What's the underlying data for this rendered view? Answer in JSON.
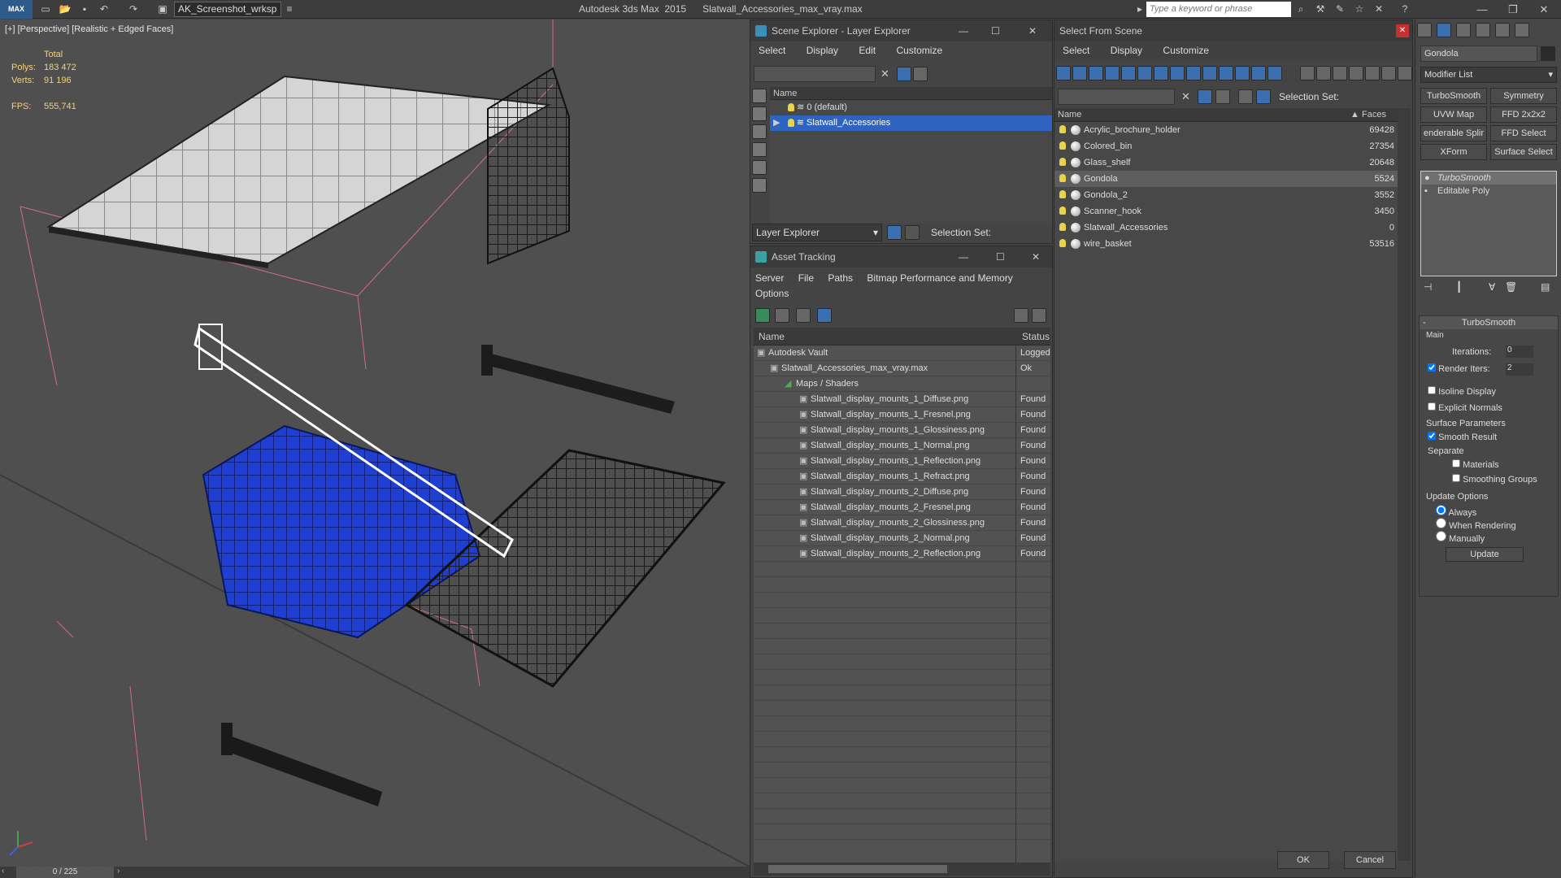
{
  "titlebar": {
    "logo": "MAX",
    "workspace": "AK_Screenshot_wrksp",
    "app_name": "Autodesk 3ds Max  2015",
    "file_name": "Slatwall_Accessories_max_vray.max",
    "search_placeholder": "Type a keyword or phrase"
  },
  "viewport": {
    "label": "[+] [Perspective] [Realistic + Edged Faces]",
    "stats_total": "Total",
    "polys_label": "Polys:",
    "polys_value": "183 472",
    "verts_label": "Verts:",
    "verts_value": "91 196",
    "fps_label": "FPS:",
    "fps_value": "555,741",
    "timeline": "0 / 225"
  },
  "scene_explorer": {
    "title": "Scene Explorer - Layer Explorer",
    "menu": [
      "Select",
      "Display",
      "Edit",
      "Customize"
    ],
    "col_name": "Name",
    "layers": [
      "0 (default)",
      "Slatwall_Accessories"
    ],
    "footer_combo": "Layer Explorer",
    "selection_set": "Selection Set:"
  },
  "asset_tracking": {
    "title": "Asset Tracking",
    "menu": [
      "Server",
      "File",
      "Paths",
      "Bitmap Performance and Memory",
      "Options"
    ],
    "col_name": "Name",
    "col_status": "Status",
    "rows": [
      {
        "name": "Autodesk Vault",
        "status": "Logged"
      },
      {
        "name": "Slatwall_Accessories_max_vray.max",
        "status": "Ok"
      },
      {
        "name": "Maps / Shaders",
        "status": ""
      },
      {
        "name": "Slatwall_display_mounts_1_Diffuse.png",
        "status": "Found"
      },
      {
        "name": "Slatwall_display_mounts_1_Fresnel.png",
        "status": "Found"
      },
      {
        "name": "Slatwall_display_mounts_1_Glossiness.png",
        "status": "Found"
      },
      {
        "name": "Slatwall_display_mounts_1_Normal.png",
        "status": "Found"
      },
      {
        "name": "Slatwall_display_mounts_1_Reflection.png",
        "status": "Found"
      },
      {
        "name": "Slatwall_display_mounts_1_Refract.png",
        "status": "Found"
      },
      {
        "name": "Slatwall_display_mounts_2_Diffuse.png",
        "status": "Found"
      },
      {
        "name": "Slatwall_display_mounts_2_Fresnel.png",
        "status": "Found"
      },
      {
        "name": "Slatwall_display_mounts_2_Glossiness.png",
        "status": "Found"
      },
      {
        "name": "Slatwall_display_mounts_2_Normal.png",
        "status": "Found"
      },
      {
        "name": "Slatwall_display_mounts_2_Reflection.png",
        "status": "Found"
      }
    ]
  },
  "select_from_scene": {
    "title": "Select From Scene",
    "menu": [
      "Select",
      "Display",
      "Customize"
    ],
    "selection_set": "Selection Set:",
    "col_name": "Name",
    "col_faces": "Faces",
    "objects": [
      {
        "name": "Acrylic_brochure_holder",
        "faces": "69428"
      },
      {
        "name": "Colored_bin",
        "faces": "27354"
      },
      {
        "name": "Glass_shelf",
        "faces": "20648"
      },
      {
        "name": "Gondola",
        "faces": "5524"
      },
      {
        "name": "Gondola_2",
        "faces": "3552"
      },
      {
        "name": "Scanner_hook",
        "faces": "3450"
      },
      {
        "name": "Slatwall_Accessories",
        "faces": "0"
      },
      {
        "name": "wire_basket",
        "faces": "53516"
      }
    ],
    "ok": "OK",
    "cancel": "Cancel"
  },
  "command_panel": {
    "object_name": "Gondola",
    "modifier_list": "Modifier List",
    "buttons": [
      "TurboSmooth",
      "Symmetry",
      "UVW Map",
      "FFD 2x2x2",
      "enderable Splir",
      "FFD Select",
      "XForm",
      "Surface Select"
    ],
    "stack": [
      "TurboSmooth",
      "Editable Poly"
    ],
    "rollout_title": "TurboSmooth",
    "main_label": "Main",
    "iterations_label": "Iterations:",
    "iterations_value": "0",
    "render_iters_label": "Render Iters:",
    "render_iters_value": "2",
    "isoline": "Isoline Display",
    "explicit_normals": "Explicit Normals",
    "surface_params": "Surface Parameters",
    "smooth_result": "Smooth Result",
    "separate": "Separate",
    "materials": "Materials",
    "smoothing_groups": "Smoothing Groups",
    "update_options": "Update Options",
    "always": "Always",
    "when_rendering": "When Rendering",
    "manually": "Manually",
    "update": "Update"
  }
}
